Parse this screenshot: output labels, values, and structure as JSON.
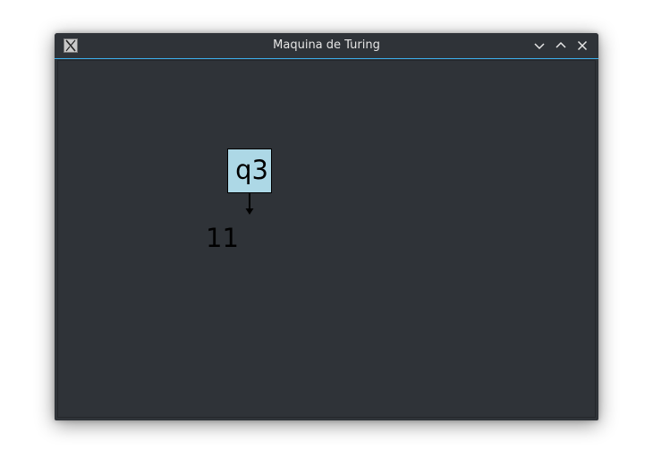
{
  "window": {
    "title": "Maquina de Turing",
    "accent_color": "#3daee9",
    "background_color": "#2f3338"
  },
  "controls": {
    "minimize_icon": "chevron-down-icon",
    "maximize_icon": "chevron-up-icon",
    "close_icon": "close-icon"
  },
  "app_icon": "x-app-icon",
  "machine": {
    "state_label": "q3",
    "state_color": "#add8e6",
    "tape_content": "11",
    "head_indicator_icon": "arrow-down-icon"
  }
}
